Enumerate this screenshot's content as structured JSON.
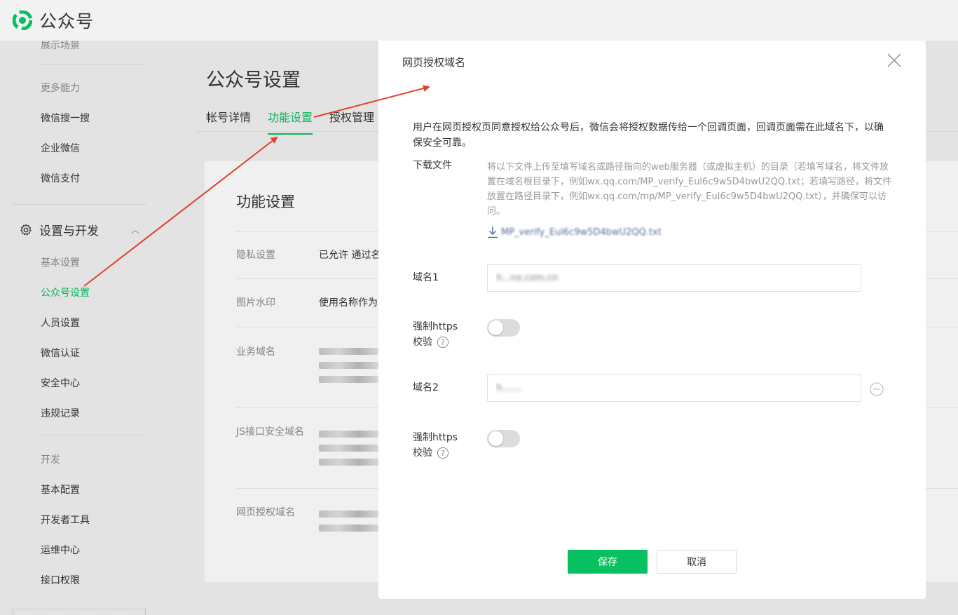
{
  "app": {
    "title": "公众号"
  },
  "sidebar": {
    "top_partial": "展示场景",
    "section_more": "更多能力",
    "more_items": [
      "微信搜一搜",
      "企业微信",
      "微信支付"
    ],
    "group_label": "设置与开发",
    "group_items": [
      "基本设置",
      "公众号设置",
      "人员设置",
      "微信认证",
      "安全中心",
      "违规记录"
    ],
    "active_item": "公众号设置",
    "section_dev": "开发",
    "dev_items": [
      "基本配置",
      "开发者工具",
      "运维中心",
      "接口权限"
    ]
  },
  "main": {
    "title": "公众号设置",
    "tabs": [
      "帐号详情",
      "功能设置",
      "授权管理"
    ],
    "active_tab": "功能设置",
    "card_title": "功能设置",
    "rows": [
      {
        "label": "隐私设置",
        "value": "已允许 通过名"
      },
      {
        "label": "图片水印",
        "value": "使用名称作为"
      },
      {
        "label": "业务域名",
        "value": ""
      },
      {
        "label": "JS接口安全域名",
        "value": ""
      },
      {
        "label": "网页授权域名",
        "value": ""
      }
    ]
  },
  "modal": {
    "title": "网页授权域名",
    "description": "用户在网页授权页同意授权给公众号后，微信会将授权数据传给一个回调页面，回调页面需在此域名下，以确保安全可靠。",
    "download_label": "下载文件",
    "download_desc": "将以下文件上传至填写域名或路径指向的web服务器（或虚拟主机）的目录（若填写域名，将文件放置在域名根目录下，例如wx.qq.com/MP_verify_Eul6c9w5D4bwU2QQ.txt；若填写路径，将文件放置在路径目录下，例如wx.qq.com/mp/MP_verify_Eul6c9w5D4bwU2QQ.txt），并确保可以访问。",
    "download_file": "MP_verify_Eul6c9w5D4bwU2QQ.txt",
    "domain1_label": "域名1",
    "domain1_value": "h...nx.com.cn",
    "https1_label": "强制https",
    "verify_label": "校验",
    "domain2_label": "域名2",
    "domain2_value": "h.......",
    "https2_label": "强制https",
    "save_label": "保存",
    "cancel_label": "取消"
  },
  "colors": {
    "accent": "#07c160",
    "arrow": "#e0412f",
    "link": "#576b95"
  },
  "icons": [
    "logo-icon",
    "gear-icon",
    "chevron-up-icon",
    "close-icon",
    "download-icon",
    "help-icon",
    "minus-circle-icon"
  ]
}
